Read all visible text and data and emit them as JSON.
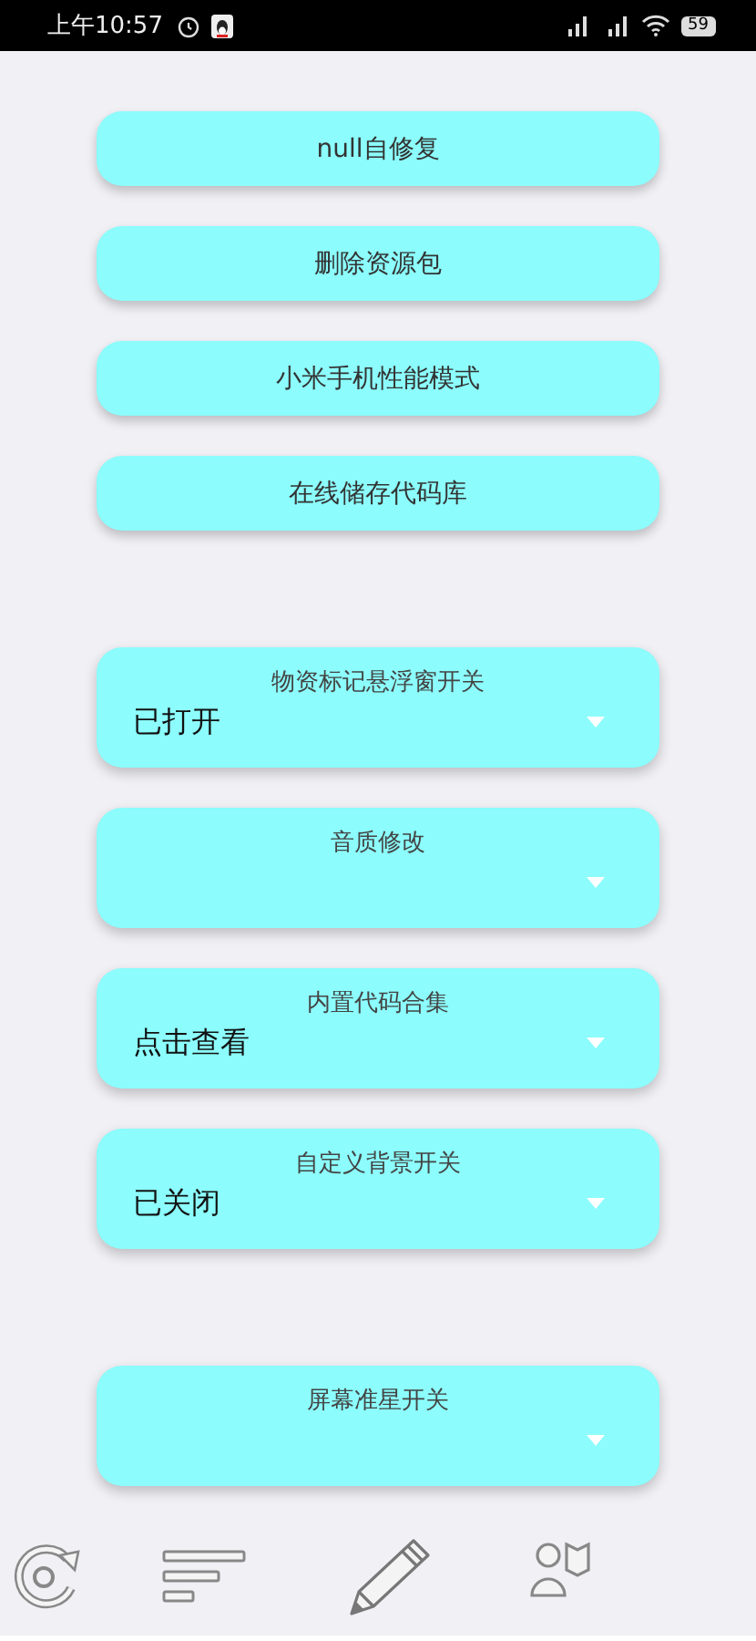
{
  "status_bar": {
    "time": "上午10:57",
    "battery": "59"
  },
  "items": [
    {
      "kind": "button",
      "label": "null自修复"
    },
    {
      "kind": "button",
      "label": "删除资源包"
    },
    {
      "kind": "button",
      "label": "小米手机性能模式"
    },
    {
      "kind": "button",
      "label": "在线储存代码库"
    },
    {
      "kind": "spacer"
    },
    {
      "kind": "dropdown",
      "title": "物资标记悬浮窗开关",
      "value": "已打开"
    },
    {
      "kind": "dropdown",
      "title": "音质修改"
    },
    {
      "kind": "dropdown",
      "title": "内置代码合集",
      "value": "点击查看"
    },
    {
      "kind": "dropdown",
      "title": "自定义背景开关",
      "value": "已关闭"
    },
    {
      "kind": "spacer"
    },
    {
      "kind": "dropdown",
      "title": "屏幕准星开关"
    }
  ],
  "bottom_nav": [
    {
      "kind": "refresh"
    },
    {
      "kind": "list"
    },
    {
      "kind": "pencil"
    },
    {
      "kind": "person"
    }
  ]
}
